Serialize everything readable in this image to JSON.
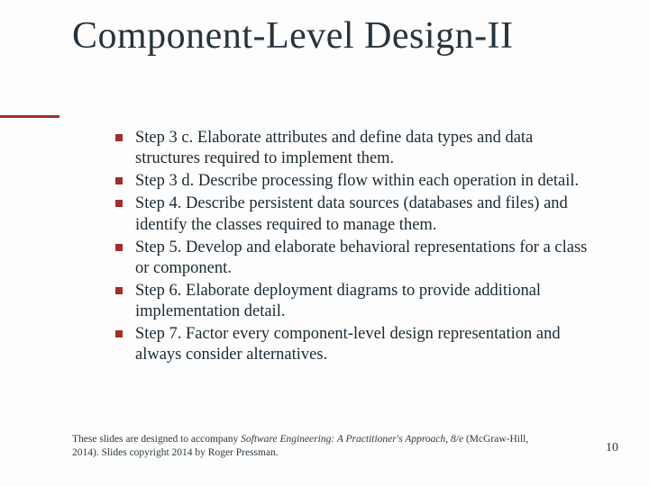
{
  "title": "Component-Level Design-II",
  "bullets": [
    "Step 3 c.  Elaborate attributes and define data types and data structures required to implement them.",
    "Step 3 d.  Describe processing flow within each operation in detail.",
    "Step 4.  Describe persistent data sources (databases and files) and identify the classes required to manage them.",
    "Step 5.  Develop and elaborate behavioral representations for a class or component.",
    "Step 6.  Elaborate deployment diagrams to provide additional implementation detail.",
    "Step 7.  Factor every component-level design representation and always consider alternatives."
  ],
  "footer": {
    "prefix": "These slides are designed to accompany ",
    "booktitle": "Software Engineering: A Practitioner's Approach, 8/e",
    "suffix": " (McGraw-Hill, 2014). Slides copyright 2014 by Roger Pressman."
  },
  "page_number": "10"
}
